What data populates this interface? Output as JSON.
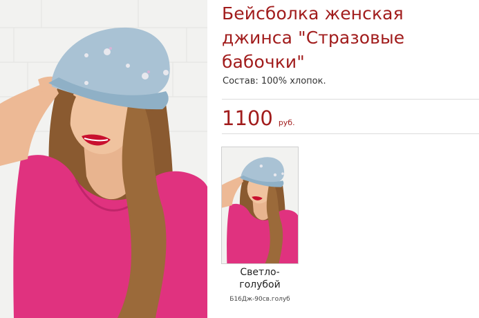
{
  "product": {
    "title": "Бейсболка женская джинса \"Стразовые бабочки\"",
    "composition": "Состав: 100% хлопок.",
    "price": "1100",
    "currency": "руб."
  },
  "variants": [
    {
      "color": "Светло-голубой",
      "sku": "Б16Дж-90св.голуб"
    }
  ],
  "colors": {
    "accent": "#a11c1c",
    "divider": "#dcdcdc"
  }
}
